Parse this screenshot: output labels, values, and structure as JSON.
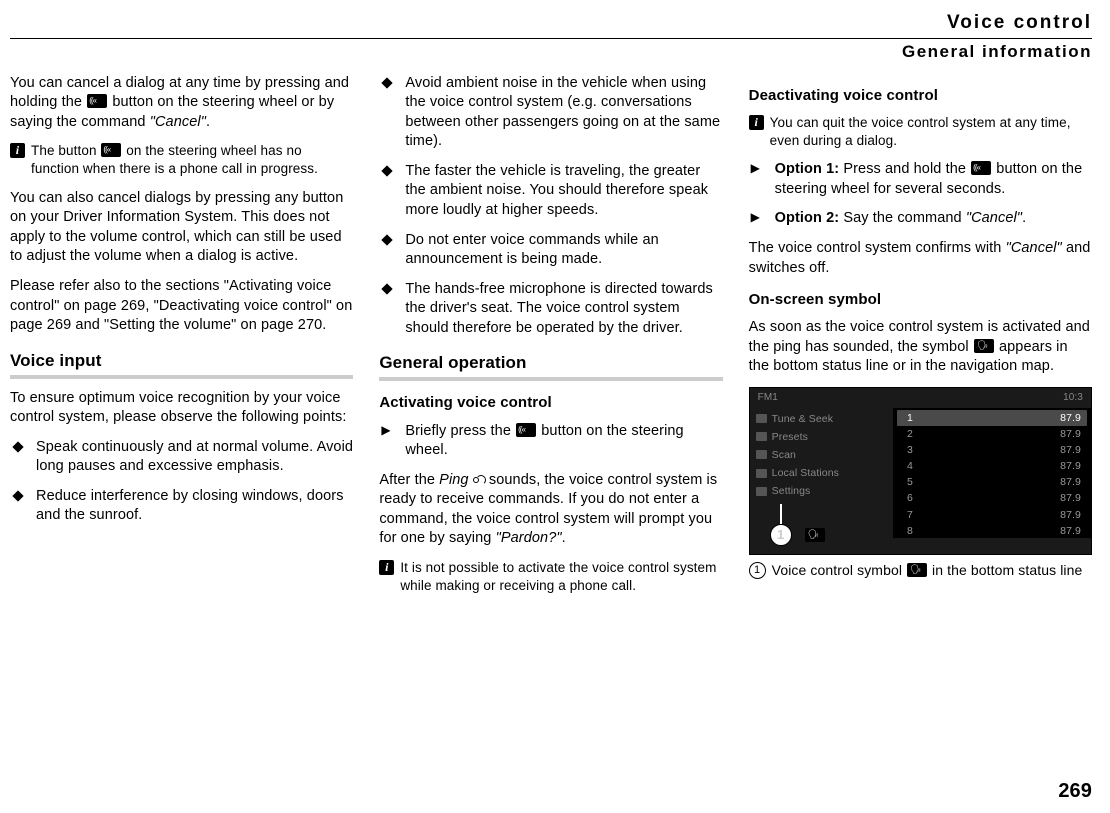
{
  "chapter": "Voice control",
  "section": "General information",
  "page_number": "269",
  "col1": {
    "p1a": "You can cancel a dialog at any time by pressing and holding the ",
    "p1b": " button on the steering wheel or by saying the command ",
    "p1c": "\"Cancel\"",
    "p1d": ".",
    "info1a": "The button ",
    "info1b": " on the steering wheel has no function when there is a phone call in progress.",
    "p2": "You can also cancel dialogs by pressing any button on your Driver Information System. This does not apply to the volume control, which can still be used to adjust the volume when a dialog is active.",
    "p3": "Please refer also to the sections \"Activating voice control\" on page 269, \"Deactivating voice control\" on page 269 and \"Setting the volume\" on page 270.",
    "h2": "Voice input",
    "p4": "To ensure optimum voice recognition by your voice control system, please observe the following points:",
    "b1": "Speak continuously and at normal volume. Avoid long pauses and excessive emphasis.",
    "b2": "Reduce interference by closing windows, doors and the sunroof."
  },
  "col2": {
    "b1": "Avoid ambient noise in the vehicle when using the voice control system (e.g. conversations between other passengers going on at the same time).",
    "b2": "The faster the vehicle is traveling, the greater the ambient noise. You should therefore speak more loudly at higher speeds.",
    "b3": "Do not enter voice commands while an announcement is being made.",
    "b4": "The hands-free microphone is directed towards the driver's seat. The voice control system should therefore be operated by the driver.",
    "h2": "General operation",
    "h3": "Activating voice control",
    "a1a": "Briefly press the ",
    "a1b": " button on the steering wheel.",
    "p1a": "After the ",
    "p1b": "Ping",
    "p1c": " sounds, the voice control system is ready to receive commands. If you do not enter a command, the voice control system will prompt you for one by saying ",
    "p1d": "\"Pardon?\"",
    "p1e": ".",
    "info1": "It is not possible to activate the voice control system while making or receiving a phone call."
  },
  "col3": {
    "h3a": "Deactivating voice control",
    "info1": "You can quit the voice control system at any time, even during a dialog.",
    "o1a": "Option 1: ",
    "o1b": "Press and hold the ",
    "o1c": " button on the steering wheel for several seconds.",
    "o2a": "Option 2: ",
    "o2b": "Say the command ",
    "o2c": "\"Cancel\"",
    "o2d": ".",
    "p1a": "The voice control system confirms with ",
    "p1b": "\"Cancel\"",
    "p1c": " and switches off.",
    "h3b": "On-screen symbol",
    "p2a": "As soon as the voice control system is activated and the ping has sounded, the symbol ",
    "p2b": " appears in the bottom status line or in the navigation map.",
    "ss": {
      "src_label": "FM1",
      "time": "10:3",
      "left": [
        "Tune & Seek",
        "Presets",
        "Scan",
        "Local Stations",
        "Settings"
      ],
      "right": [
        {
          "n": "1",
          "v": "87.9"
        },
        {
          "n": "2",
          "v": "87.9"
        },
        {
          "n": "3",
          "v": "87.9"
        },
        {
          "n": "4",
          "v": "87.9"
        },
        {
          "n": "5",
          "v": "87.9"
        },
        {
          "n": "6",
          "v": "87.9"
        },
        {
          "n": "7",
          "v": "87.9"
        },
        {
          "n": "8",
          "v": "87.9"
        }
      ],
      "callout": "1"
    },
    "cap_n": "1",
    "cap_a": "Voice control symbol ",
    "cap_b": " in the bottom status line"
  }
}
